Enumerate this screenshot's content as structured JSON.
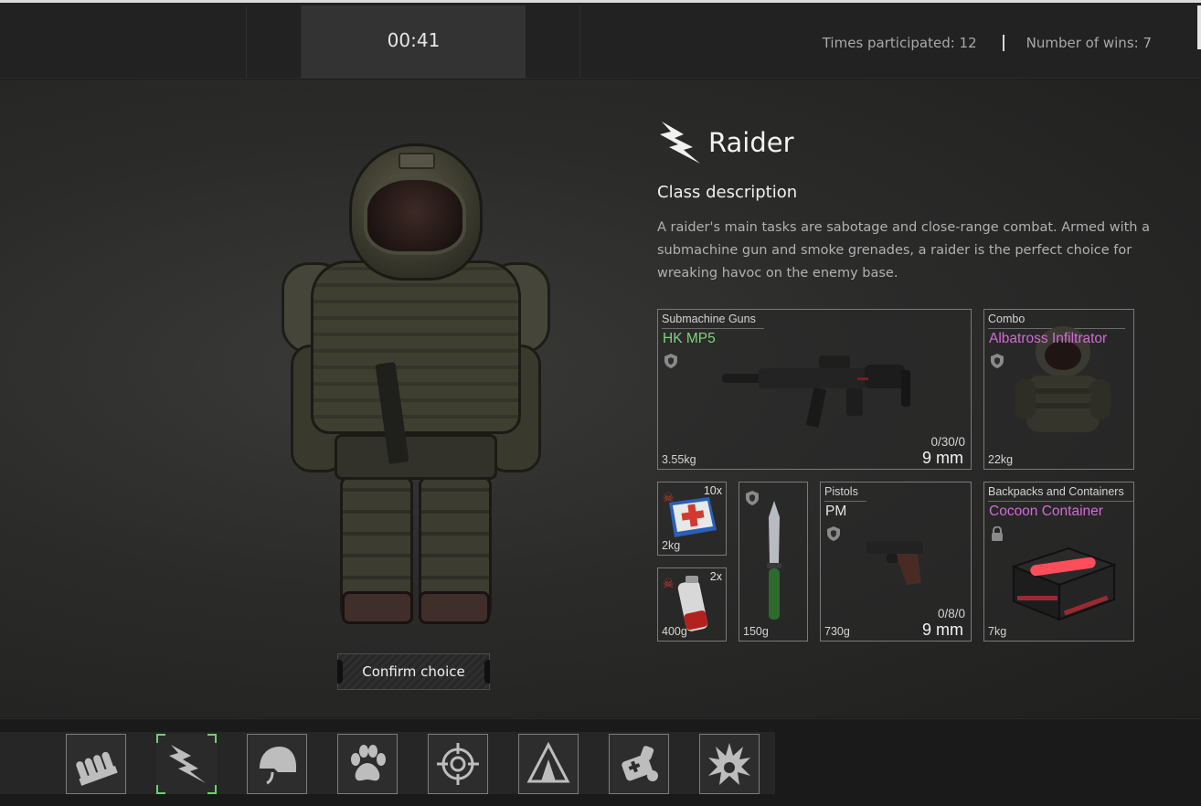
{
  "header": {
    "timer": "00:41",
    "times_participated": "Times participated: 12",
    "number_of_wins": "Number of wins: 7"
  },
  "class_info": {
    "icon": "lightning-bolt-icon",
    "name": "Raider",
    "description_title": "Class description",
    "description": "A raider's main tasks are sabotage and close-range combat. Armed with a submachine gun and smoke grenades, a raider is the perfect choice for wreaking havoc on the enemy base."
  },
  "confirm_label": "Confirm choice",
  "loadout": {
    "primary": {
      "category": "Submachine Guns",
      "name": "HK MP5",
      "name_color": "#7ed37e",
      "weight": "3.55kg",
      "ammo": "0/30/0",
      "caliber": "9 mm",
      "icon": "shield-icon"
    },
    "armor": {
      "category": "Combo",
      "name": "Albatross Infiltrator",
      "name_color": "#d26bd6",
      "weight": "22kg",
      "icon": "shield-icon"
    },
    "medkit": {
      "count": "10x",
      "weight": "2kg",
      "icon": "skull-icon"
    },
    "grenade": {
      "count": "2x",
      "weight": "400g",
      "icon": "skull-icon"
    },
    "knife": {
      "weight": "150g",
      "icon": "shield-icon"
    },
    "pistol": {
      "category": "Pistols",
      "name": "PM",
      "name_color": "#e6e6e6",
      "weight": "730g",
      "ammo": "0/8/0",
      "caliber": "9 mm",
      "icon": "shield-icon"
    },
    "container": {
      "category": "Backpacks and Containers",
      "name": "Cocoon Container",
      "name_color": "#d26bd6",
      "weight": "7kg",
      "icon": "lock-icon"
    }
  },
  "class_tabs": [
    {
      "name": "ammo-belt-icon"
    },
    {
      "name": "lightning-bolt-icon",
      "selected": true
    },
    {
      "name": "helmet-icon"
    },
    {
      "name": "paw-print-icon"
    },
    {
      "name": "crosshair-icon"
    },
    {
      "name": "tent-icon"
    },
    {
      "name": "medic-kit-icon"
    },
    {
      "name": "explosion-icon"
    }
  ]
}
